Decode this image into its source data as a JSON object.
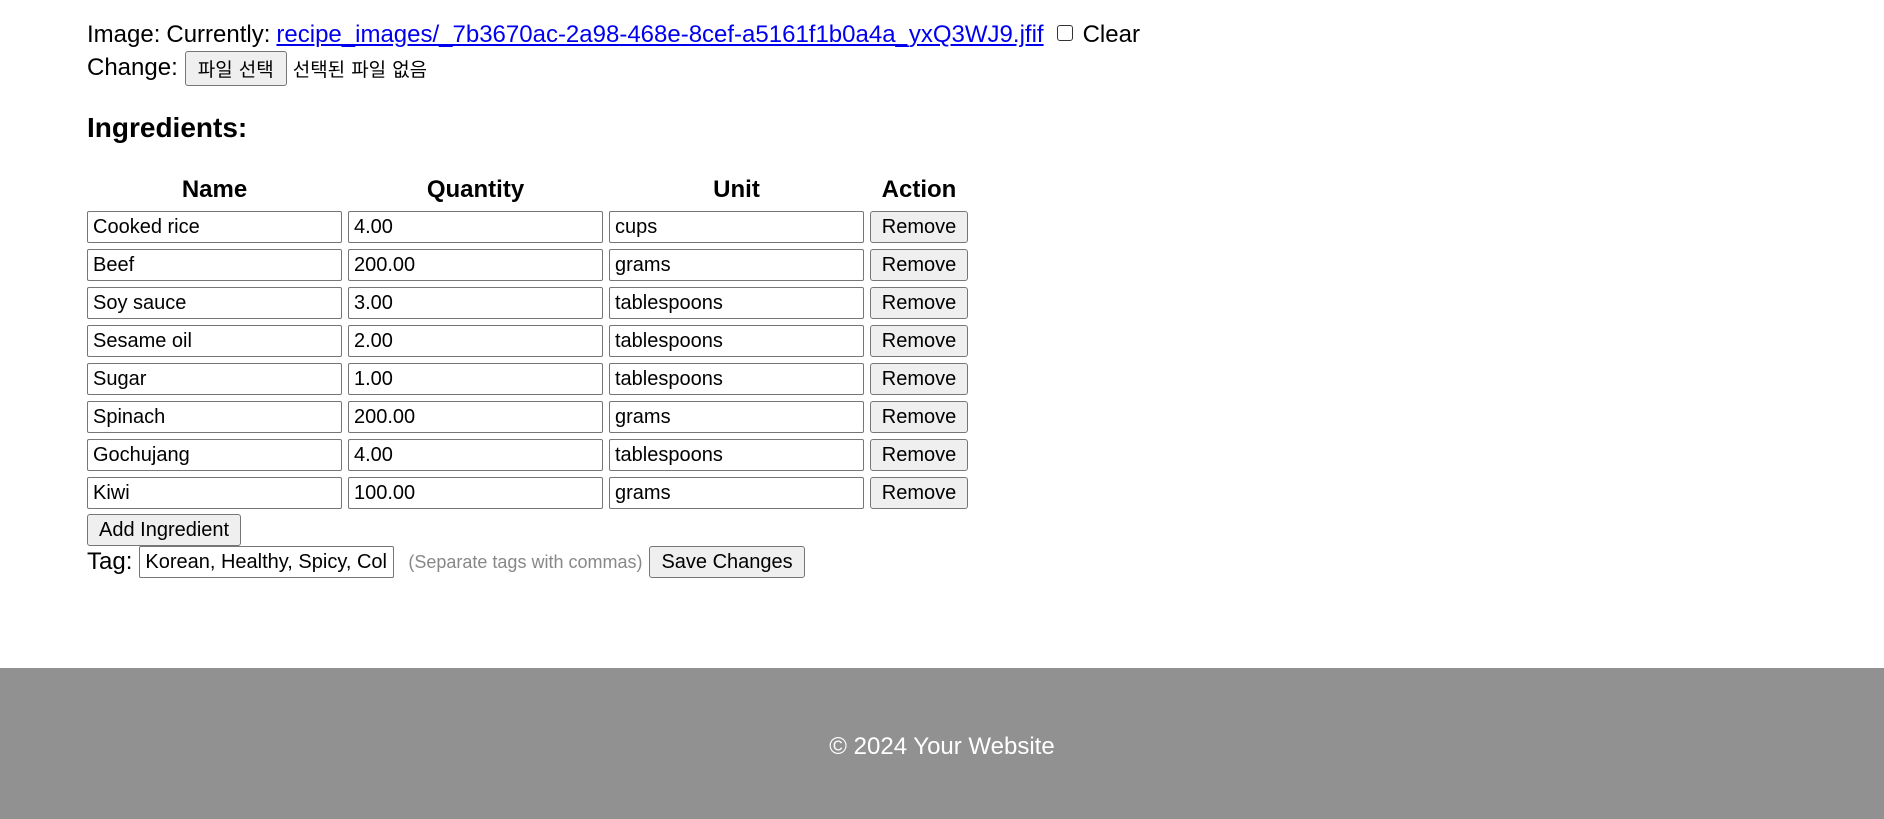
{
  "image": {
    "label": "Image:",
    "currently_label": "Currently:",
    "file_link": "recipe_images/_7b3670ac-2a98-468e-8cef-a5161f1b0a4a_yxQ3WJ9.jfif",
    "clear_checked": false,
    "clear_label": "Clear"
  },
  "change": {
    "label": "Change:",
    "choose_file_label": "파일 선택",
    "no_file_text": "선택된 파일 없음"
  },
  "ingredients": {
    "heading": "Ingredients:",
    "columns": [
      "Name",
      "Quantity",
      "Unit",
      "Action"
    ],
    "rows": [
      {
        "name": "Cooked rice",
        "quantity": "4.00",
        "unit": "cups",
        "action": "Remove"
      },
      {
        "name": "Beef",
        "quantity": "200.00",
        "unit": "grams",
        "action": "Remove"
      },
      {
        "name": "Soy sauce",
        "quantity": "3.00",
        "unit": "tablespoons",
        "action": "Remove"
      },
      {
        "name": "Sesame oil",
        "quantity": "2.00",
        "unit": "tablespoons",
        "action": "Remove"
      },
      {
        "name": "Sugar",
        "quantity": "1.00",
        "unit": "tablespoons",
        "action": "Remove"
      },
      {
        "name": "Spinach",
        "quantity": "200.00",
        "unit": "grams",
        "action": "Remove"
      },
      {
        "name": "Gochujang",
        "quantity": "4.00",
        "unit": "tablespoons",
        "action": "Remove"
      },
      {
        "name": "Kiwi",
        "quantity": "100.00",
        "unit": "grams",
        "action": "Remove"
      }
    ],
    "add_label": "Add Ingredient"
  },
  "tag": {
    "label": "Tag:",
    "value": "Korean, Healthy, Spicy, Col",
    "hint": "(Separate tags with commas)",
    "save_label": "Save Changes"
  },
  "footer": {
    "text": "© 2024 Your Website",
    "background": "#919191"
  }
}
